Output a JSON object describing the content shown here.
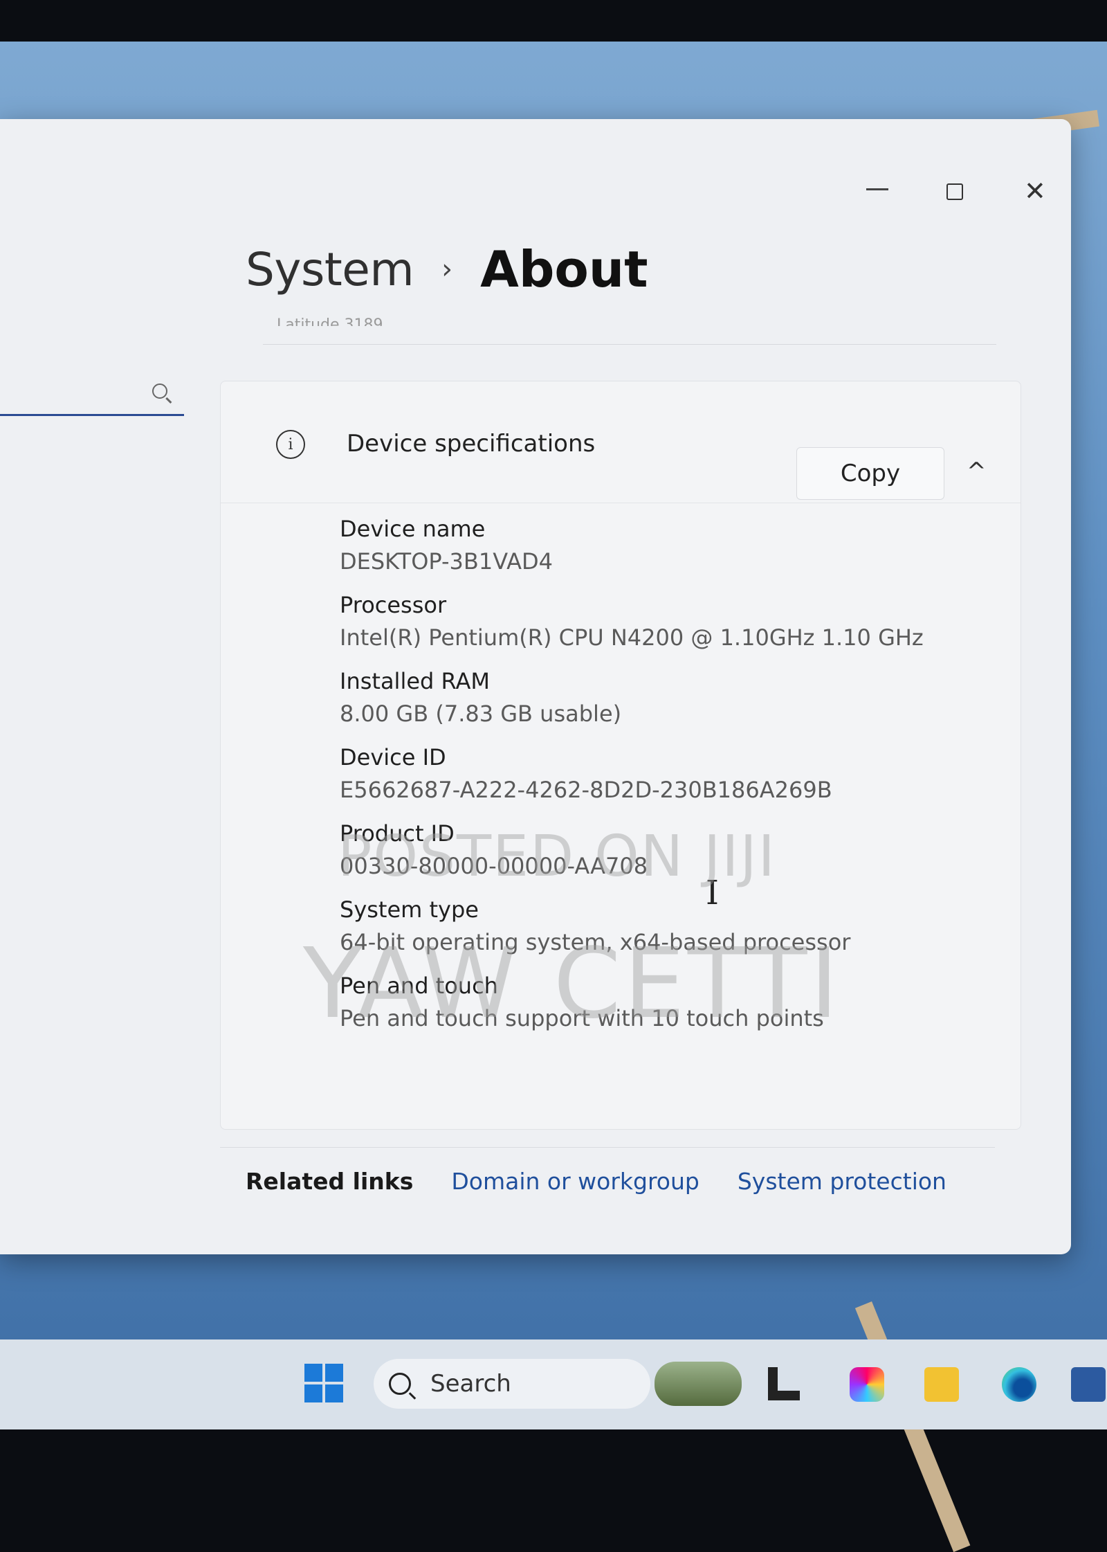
{
  "window": {
    "minimize_label": "—",
    "close_label": "✕"
  },
  "breadcrumb": {
    "root": "System",
    "separator": "›",
    "current": "About"
  },
  "ghost_text": "Latitude 3189",
  "device_specs": {
    "title": "Device specifications",
    "copy_label": "Copy",
    "collapse_glyph": "^",
    "items": [
      {
        "label": "Device name",
        "value": "DESKTOP-3B1VAD4"
      },
      {
        "label": "Processor",
        "value": "Intel(R) Pentium(R) CPU N4200 @ 1.10GHz   1.10 GHz"
      },
      {
        "label": "Installed RAM",
        "value": "8.00 GB (7.83 GB usable)"
      },
      {
        "label": "Device ID",
        "value": "E5662687-A222-4262-8D2D-230B186A269B"
      },
      {
        "label": "Product ID",
        "value": "00330-80000-00000-AA708"
      },
      {
        "label": "System type",
        "value": "64-bit operating system, x64-based processor"
      },
      {
        "label": "Pen and touch",
        "value": "Pen and touch support with 10 touch points"
      }
    ]
  },
  "related_links": {
    "label": "Related links",
    "links": [
      "Domain or workgroup",
      "System protection"
    ]
  },
  "watermark": {
    "line1": "POSTED ON JIJI",
    "line2": "YAW CETTI"
  },
  "taskbar": {
    "search_label": "Search"
  },
  "icons": {
    "info": "i",
    "ibeam": "I"
  }
}
